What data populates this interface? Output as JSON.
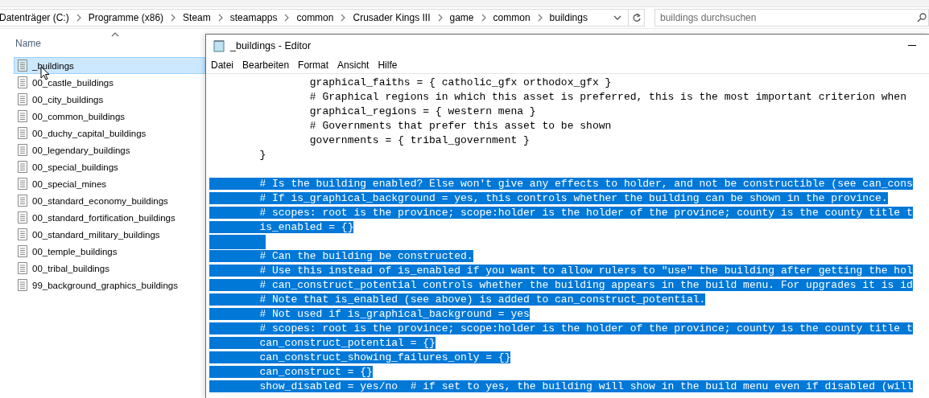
{
  "explorer": {
    "breadcrumbs": [
      "Datenträger (C:)",
      "Programme (x86)",
      "Steam",
      "steamapps",
      "common",
      "Crusader Kings III",
      "game",
      "common",
      "buildings"
    ],
    "search": {
      "placeholder": "buildings durchsuchen"
    },
    "column_header": "Name",
    "files": [
      {
        "name": "_buildings",
        "selected": true
      },
      {
        "name": "00_castle_buildings",
        "selected": false
      },
      {
        "name": "00_city_buildings",
        "selected": false
      },
      {
        "name": "00_common_buildings",
        "selected": false
      },
      {
        "name": "00_duchy_capital_buildings",
        "selected": false
      },
      {
        "name": "00_legendary_buildings",
        "selected": false
      },
      {
        "name": "00_special_buildings",
        "selected": false
      },
      {
        "name": "00_special_mines",
        "selected": false
      },
      {
        "name": "00_standard_economy_buildings",
        "selected": false
      },
      {
        "name": "00_standard_fortification_buildings",
        "selected": false
      },
      {
        "name": "00_standard_military_buildings",
        "selected": false
      },
      {
        "name": "00_temple_buildings",
        "selected": false
      },
      {
        "name": "00_tribal_buildings",
        "selected": false
      },
      {
        "name": "99_background_graphics_buildings",
        "selected": false
      }
    ]
  },
  "editor": {
    "title": "_buildings - Editor",
    "menu": [
      "Datei",
      "Bearbeiten",
      "Format",
      "Ansicht",
      "Hilfe"
    ],
    "lines": [
      {
        "text": "                graphical_faiths = { catholic_gfx orthodox_gfx }",
        "selected": false
      },
      {
        "text": "                # Graphical regions in which this asset is preferred, this is the most important criterion when",
        "selected": false
      },
      {
        "text": "                graphical_regions = { western mena }",
        "selected": false
      },
      {
        "text": "                # Governments that prefer this asset to be shown",
        "selected": false
      },
      {
        "text": "                governments = { tribal_government }",
        "selected": false
      },
      {
        "text": "        }",
        "selected": false
      },
      {
        "selected": false
      },
      {
        "text": "        # Is the building enabled? Else won't give any effects to holder, and not be constructible (see can_cons",
        "selected": true
      },
      {
        "text": "        # If is_graphical_background = yes, this controls whether the building can be shown in the province.",
        "selected": true
      },
      {
        "text": "        # scopes: root is the province; scope:holder is the holder of the province; county is the county title t",
        "selected": true
      },
      {
        "text": "        is_enabled = {}",
        "selected": true
      },
      {
        "selected": true
      },
      {
        "text": "        # Can the building be constructed.",
        "selected": true
      },
      {
        "text": "        # Use this instead of is_enabled if you want to allow rulers to \"use\" the building after getting the hol",
        "selected": true
      },
      {
        "text": "        # can_construct_potential controls whether the building appears in the build menu. For upgrades it is id",
        "selected": true
      },
      {
        "text": "        # Note that is_enabled (see above) is added to can_construct_potential.",
        "selected": true
      },
      {
        "text": "        # Not used if is_graphical_background = yes",
        "selected": true
      },
      {
        "text": "        # scopes: root is the province; scope:holder is the holder of the province; county is the county title t",
        "selected": true
      },
      {
        "text": "        can_construct_potential = {}",
        "selected": true
      },
      {
        "text": "        can_construct_showing_failures_only = {}",
        "selected": true
      },
      {
        "text": "        can_construct = {}",
        "selected": true
      },
      {
        "text": "        show_disabled = yes/no  # if set to yes, the building will show in the build menu even if disabled (will",
        "selected": true
      }
    ]
  }
}
